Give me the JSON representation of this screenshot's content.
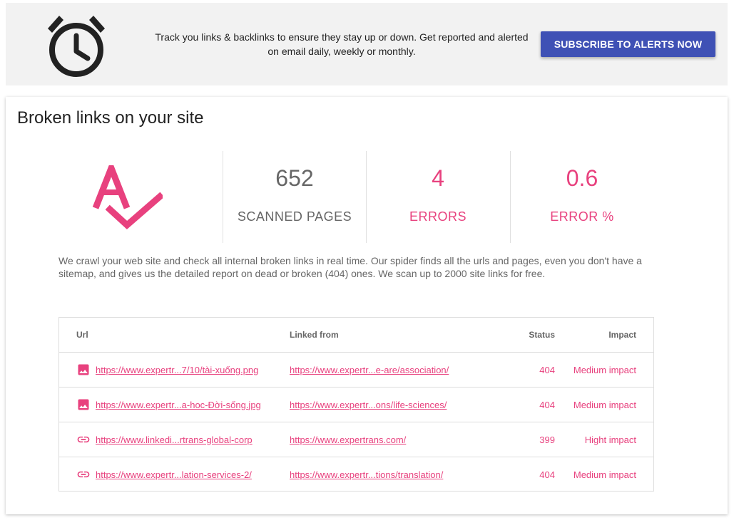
{
  "banner": {
    "icon": "alarm-clock-icon",
    "text": "Track you links & backlinks to ensure they stay up or down. Get reported and alerted on email daily, weekly or monthly.",
    "button_label": "SUBSCRIBE TO ALERTS NOW",
    "button_color": "#3f51b5"
  },
  "card": {
    "title": "Broken links on your site",
    "logo": "spellcheck-icon",
    "accent_color": "#e8417e",
    "stats": [
      {
        "value": "652",
        "label": "SCANNED PAGES"
      },
      {
        "value": "4",
        "label": "ERRORS"
      },
      {
        "value": "0.6",
        "label": "ERROR %"
      }
    ],
    "description": "We crawl your web site and check all internal broken links in real time. Our spider finds all the urls and pages, even you don't have a sitemap, and gives us the detailed report on dead or broken (404) ones. We scan up to 2000 site links for free."
  },
  "table": {
    "headers": {
      "url": "Url",
      "linked_from": "Linked from",
      "status": "Status",
      "impact": "Impact"
    },
    "rows": [
      {
        "icon": "image-icon",
        "url": "https://www.expertr...7/10/tài-xuống.png",
        "linked_from": "https://www.expertr...e-are/association/",
        "status": "404",
        "impact": "Medium impact"
      },
      {
        "icon": "image-icon",
        "url": "https://www.expertr...a-hoc-Đời-sống.jpg",
        "linked_from": "https://www.expertr...ons/life-sciences/",
        "status": "404",
        "impact": "Medium impact"
      },
      {
        "icon": "link-icon",
        "url": "https://www.linkedi...rtrans-global-corp",
        "linked_from": "https://www.expertrans.com/",
        "status": "399",
        "impact": "Hight impact"
      },
      {
        "icon": "link-icon",
        "url": "https://www.expertr...lation-services-2/",
        "linked_from": "https://www.expertr...tions/translation/",
        "status": "404",
        "impact": "Medium impact"
      }
    ]
  }
}
